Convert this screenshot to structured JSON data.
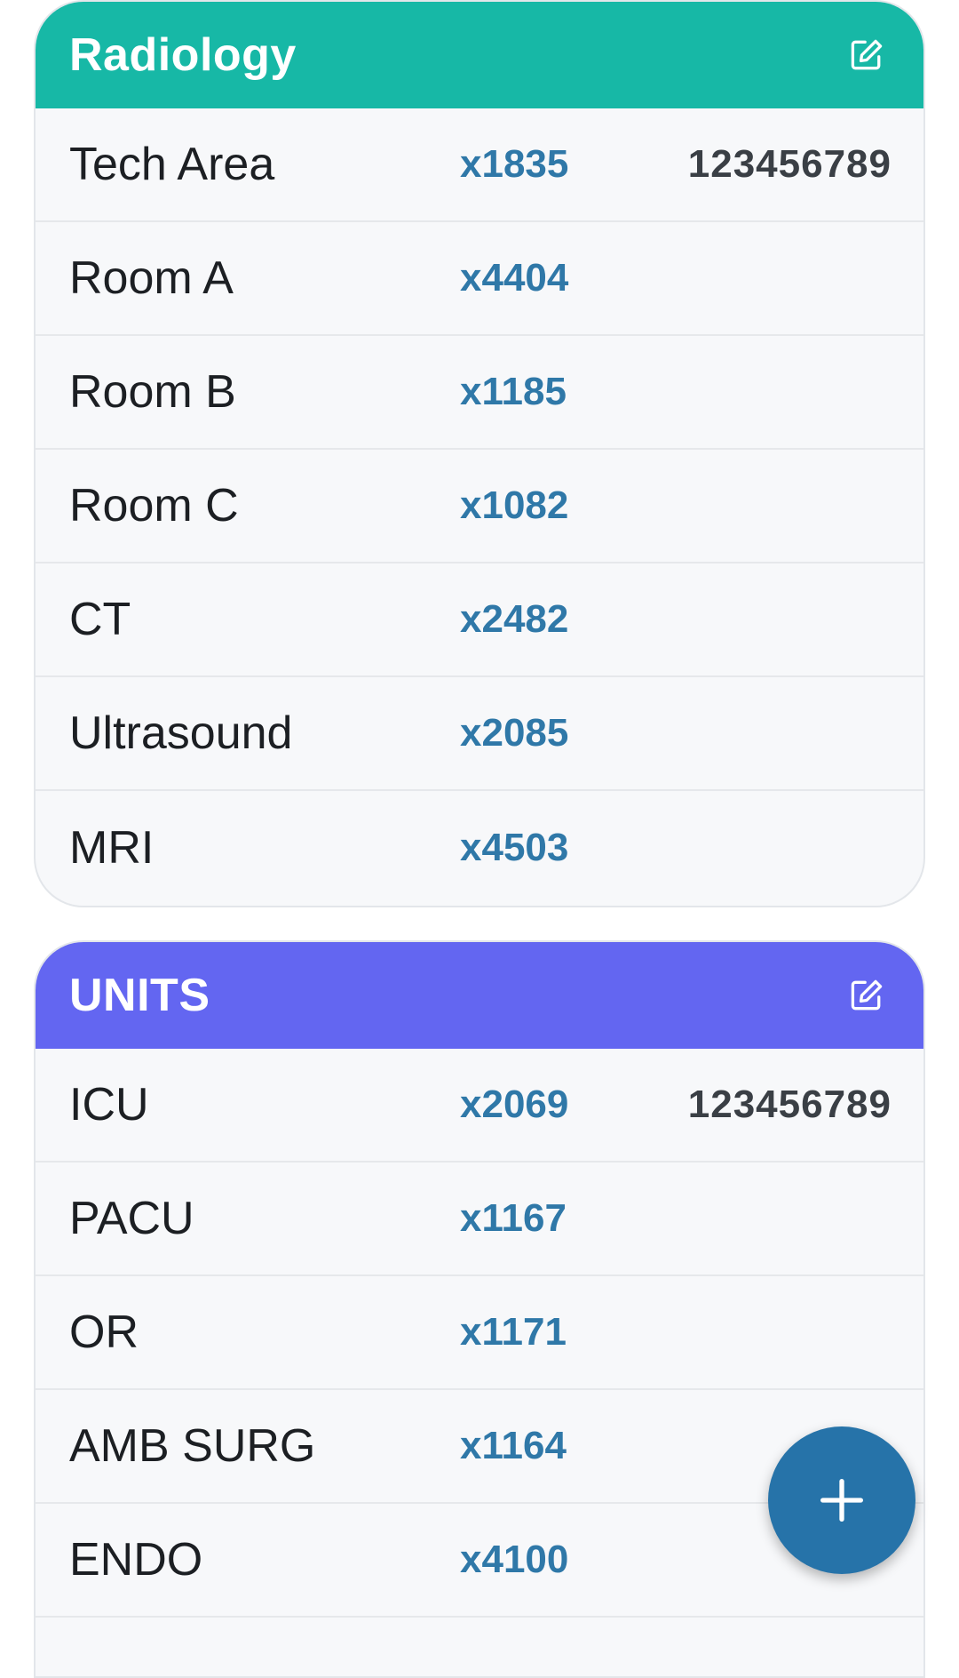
{
  "colors": {
    "radiology_header": "#17b8a6",
    "units_header": "#6366f1",
    "extension_text": "#2f78a8",
    "fab": "#2673a9"
  },
  "sections": [
    {
      "title": "Radiology",
      "edit_icon": "edit-square-icon",
      "rows": [
        {
          "name": "Tech Area",
          "ext": "x1835",
          "phone": "123456789"
        },
        {
          "name": "Room A",
          "ext": "x4404",
          "phone": ""
        },
        {
          "name": "Room B",
          "ext": "x1185",
          "phone": ""
        },
        {
          "name": "Room C",
          "ext": "x1082",
          "phone": ""
        },
        {
          "name": "CT",
          "ext": "x2482",
          "phone": ""
        },
        {
          "name": "Ultrasound",
          "ext": "x2085",
          "phone": ""
        },
        {
          "name": "MRI",
          "ext": "x4503",
          "phone": ""
        }
      ]
    },
    {
      "title": "UNITS",
      "edit_icon": "edit-square-icon",
      "rows": [
        {
          "name": "ICU",
          "ext": "x2069",
          "phone": "123456789"
        },
        {
          "name": "PACU",
          "ext": "x1167",
          "phone": ""
        },
        {
          "name": "OR",
          "ext": "x1171",
          "phone": ""
        },
        {
          "name": "AMB SURG",
          "ext": "x1164",
          "phone": ""
        },
        {
          "name": "ENDO",
          "ext": "x4100",
          "phone": ""
        }
      ]
    }
  ],
  "fab": {
    "icon": "plus-icon"
  }
}
